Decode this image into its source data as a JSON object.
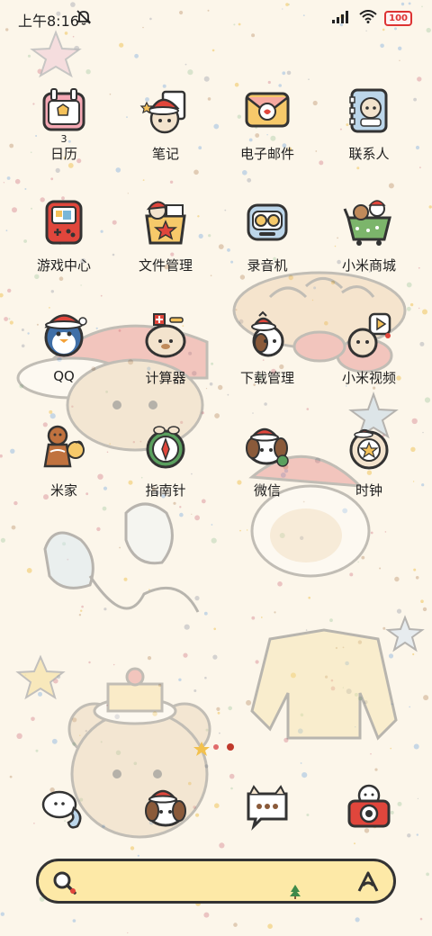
{
  "status_bar": {
    "time": "上午8:16",
    "icons": [
      "mute-bell-icon",
      "signal-icon",
      "wifi-icon",
      "battery-icon"
    ],
    "battery_label": "100"
  },
  "home": {
    "apps": [
      {
        "label": "日历",
        "icon": "calendar-icon",
        "badge": "3"
      },
      {
        "label": "笔记",
        "icon": "notes-icon"
      },
      {
        "label": "电子邮件",
        "icon": "email-icon"
      },
      {
        "label": "联系人",
        "icon": "contacts-icon"
      },
      {
        "label": "游戏中心",
        "icon": "game-center-icon"
      },
      {
        "label": "文件管理",
        "icon": "file-manager-icon"
      },
      {
        "label": "录音机",
        "icon": "recorder-icon"
      },
      {
        "label": "小米商城",
        "icon": "mi-store-icon"
      },
      {
        "label": "QQ",
        "icon": "qq-icon"
      },
      {
        "label": "计算器",
        "icon": "calculator-icon"
      },
      {
        "label": "下载管理",
        "icon": "download-manager-icon"
      },
      {
        "label": "小米视频",
        "icon": "mi-video-icon"
      },
      {
        "label": "米家",
        "icon": "mi-home-icon"
      },
      {
        "label": "指南针",
        "icon": "compass-icon"
      },
      {
        "label": "微信",
        "icon": "wechat-icon"
      },
      {
        "label": "时钟",
        "icon": "clock-icon"
      }
    ],
    "dock": [
      {
        "icon": "phone-icon"
      },
      {
        "icon": "messages-icon"
      },
      {
        "icon": "chat-icon"
      },
      {
        "icon": "camera-icon"
      }
    ]
  },
  "search_bar": {
    "placeholder": "",
    "icons": [
      "search-icon",
      "voice-icon",
      "tree-icon"
    ]
  },
  "colors": {
    "background": "#fcf6ea",
    "search_fill": "#fde9a7",
    "accent_red": "#e0463c",
    "outline": "#333333"
  }
}
